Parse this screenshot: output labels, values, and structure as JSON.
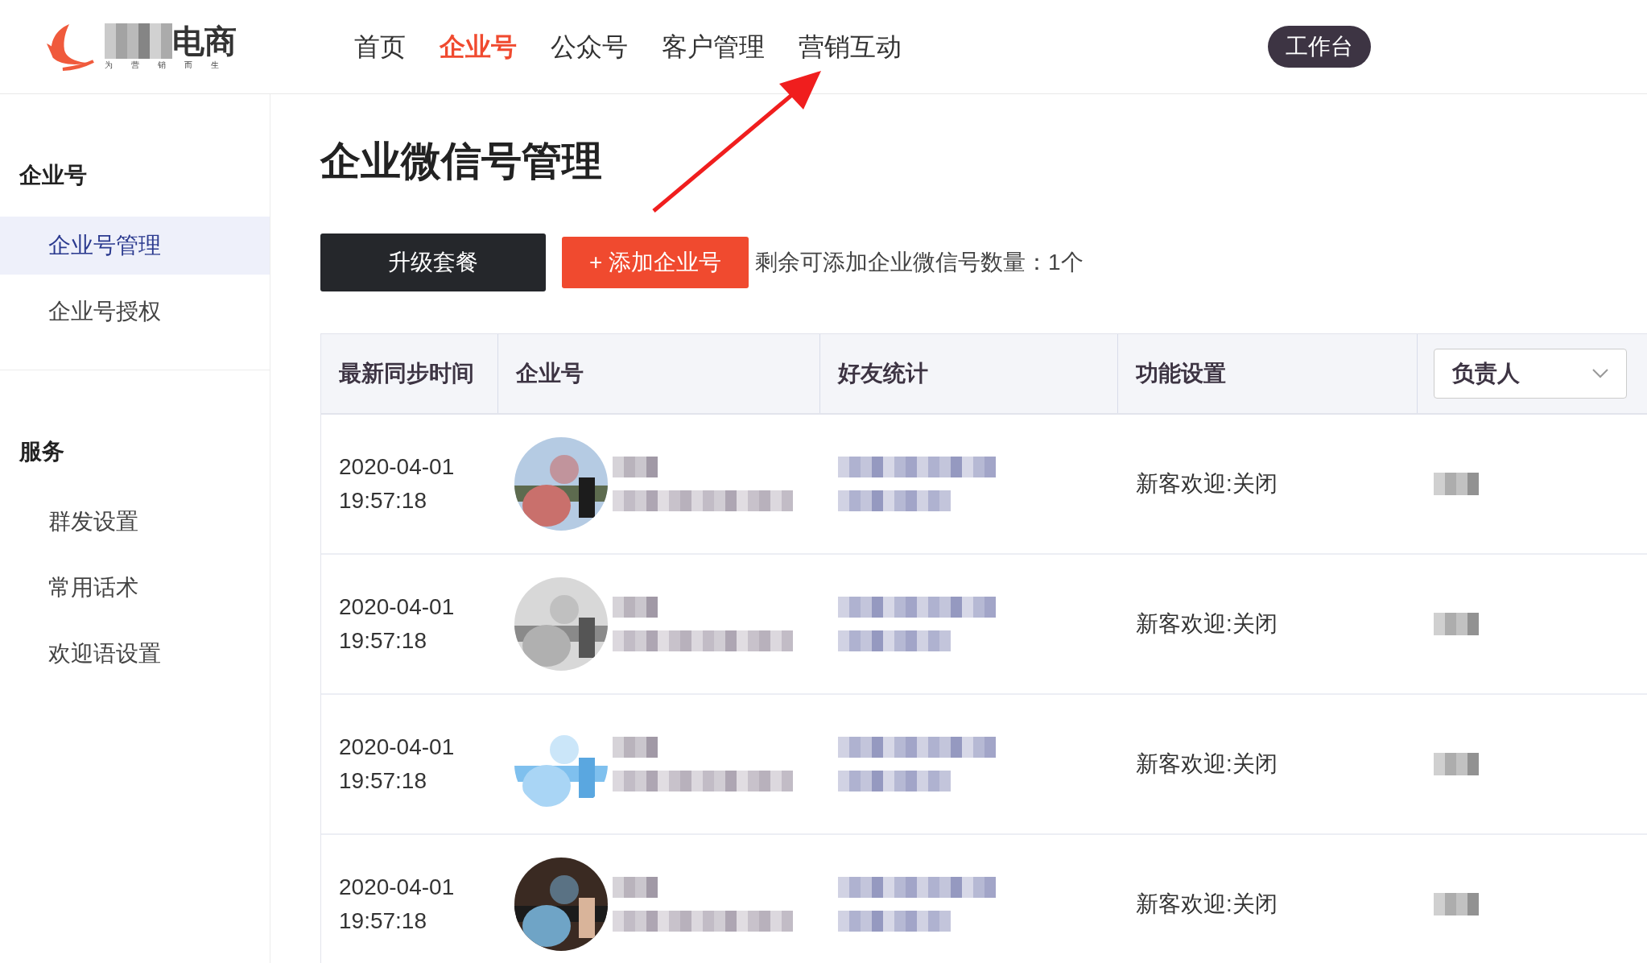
{
  "logo": {
    "text": "电商",
    "tagline": "为营销而生"
  },
  "nav": [
    {
      "label": "首页",
      "selected": false
    },
    {
      "label": "企业号",
      "selected": true
    },
    {
      "label": "公众号",
      "selected": false
    },
    {
      "label": "客户管理",
      "selected": false
    },
    {
      "label": "营销互动",
      "selected": false
    }
  ],
  "workbench_button": "工作台",
  "sidebar": [
    {
      "title": "企业号",
      "items": [
        {
          "label": "企业号管理",
          "selected": true
        },
        {
          "label": "企业号授权",
          "selected": false
        }
      ]
    },
    {
      "title": "服务",
      "items": [
        {
          "label": "群发设置",
          "selected": false
        },
        {
          "label": "常用话术",
          "selected": false
        },
        {
          "label": "欢迎语设置",
          "selected": false
        }
      ]
    }
  ],
  "page_title": "企业微信号管理",
  "upgrade_button": "升级套餐",
  "add_button": "+ 添加企业号",
  "quota_text": "剩余可添加企业微信号数量：1个",
  "table": {
    "columns": [
      "最新同步时间",
      "企业号",
      "好友统计",
      "功能设置"
    ],
    "owner_filter": {
      "label": "负责人"
    },
    "rows": [
      {
        "date": "2020-04-01",
        "time": "19:57:18",
        "feature": "新客欢迎:关闭"
      },
      {
        "date": "2020-04-01",
        "time": "19:57:18",
        "feature": "新客欢迎:关闭"
      },
      {
        "date": "2020-04-01",
        "time": "19:57:18",
        "feature": "新客欢迎:关闭"
      },
      {
        "date": "2020-04-01",
        "time": "19:57:18",
        "feature": "新客欢迎:关闭"
      }
    ]
  }
}
